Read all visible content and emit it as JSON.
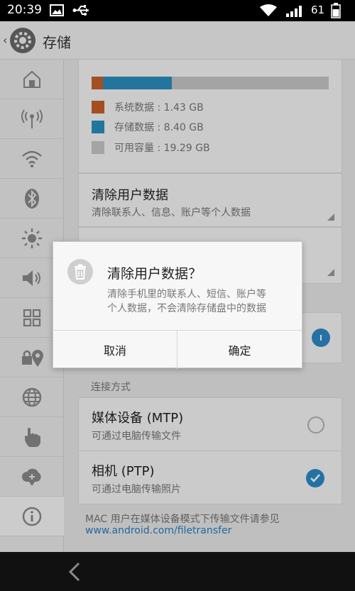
{
  "status_bar": {
    "time": "20:39",
    "battery": "61",
    "icons": [
      "picture-icon",
      "usb-icon",
      "wifi-icon",
      "signal-icon",
      "battery-icon"
    ]
  },
  "app_bar": {
    "title": "存储",
    "icon": "gear-icon"
  },
  "sidebar": {
    "items": [
      {
        "icon": "home-icon"
      },
      {
        "icon": "broadcast-icon"
      },
      {
        "icon": "wifi-icon"
      },
      {
        "icon": "bluetooth-icon"
      },
      {
        "icon": "brightness-icon"
      },
      {
        "icon": "volume-icon"
      },
      {
        "icon": "apps-grid-icon"
      },
      {
        "icon": "location-lock-icon"
      },
      {
        "icon": "globe-icon"
      },
      {
        "icon": "hand-icon"
      },
      {
        "icon": "cloud-icon"
      },
      {
        "icon": "info-icon"
      }
    ]
  },
  "storage": {
    "segments": [
      {
        "label": "系统数据 : 1.43 GB",
        "value_gb": 1.43,
        "color": "#c8612a"
      },
      {
        "label": "存储数据 : 8.40 GB",
        "value_gb": 8.4,
        "color": "#2a8fc0"
      },
      {
        "label": "可用容量 : 19.29 GB",
        "value_gb": 19.29,
        "color": "#c9c9c9"
      }
    ],
    "clear_user_data": {
      "title": "清除用户数据",
      "summary": "清除联系人、信息、账户等个人数据"
    }
  },
  "connection": {
    "section_label": "连接方式",
    "options": [
      {
        "title": "媒体设备 (MTP)",
        "summary": "可通过电脑传输文件",
        "checked": false
      },
      {
        "title": "相机 (PTP)",
        "summary": "可通过电脑传输照片",
        "checked": true
      }
    ],
    "footer_note": "MAC 用户在媒体设备模式下传输文件请参见",
    "footer_link": "www.android.com/filetransfer"
  },
  "dialog": {
    "icon": "trash-icon",
    "title": "清除用户数据？",
    "message_line1": "清除手机里的联系人、短信、账户等",
    "message_line2": "个人数据，不会清除存储盘中的数据",
    "cancel_label": "取消",
    "ok_label": "确定"
  },
  "nav_bar": {
    "back_icon": "back-arrow-icon"
  }
}
